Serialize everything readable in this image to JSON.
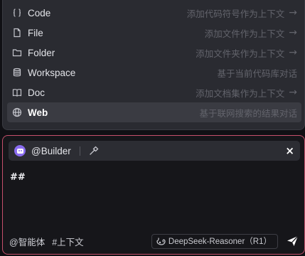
{
  "context_menu": {
    "items": [
      {
        "icon": "braces-icon",
        "label": "Code",
        "desc": "添加代码符号作为上下文",
        "arrow": "→",
        "selected": false
      },
      {
        "icon": "file-icon",
        "label": "File",
        "desc": "添加文件作为上下文",
        "arrow": "→",
        "selected": false
      },
      {
        "icon": "folder-icon",
        "label": "Folder",
        "desc": "添加文件夹作为上下文",
        "arrow": "→",
        "selected": false
      },
      {
        "icon": "database-icon",
        "label": "Workspace",
        "desc": "基于当前代码库对话",
        "arrow": "",
        "selected": false
      },
      {
        "icon": "book-icon",
        "label": "Doc",
        "desc": "添加文档集作为上下文",
        "arrow": "→",
        "selected": false
      },
      {
        "icon": "globe-icon",
        "label": "Web",
        "desc": "基于联网搜索的结果对话",
        "arrow": "",
        "selected": true
      }
    ]
  },
  "chat": {
    "agent_name": "@Builder",
    "close_label": "×",
    "input_text": "##",
    "agent_link": "@智能体",
    "context_link": "#上下文",
    "model_name": "DeepSeek-Reasoner（R1）"
  },
  "colors": {
    "panel_border": "#c6506c",
    "avatar": "#8a6cf0",
    "popup_bg": "#2a2b31",
    "selected_bg": "#3a3b42"
  }
}
